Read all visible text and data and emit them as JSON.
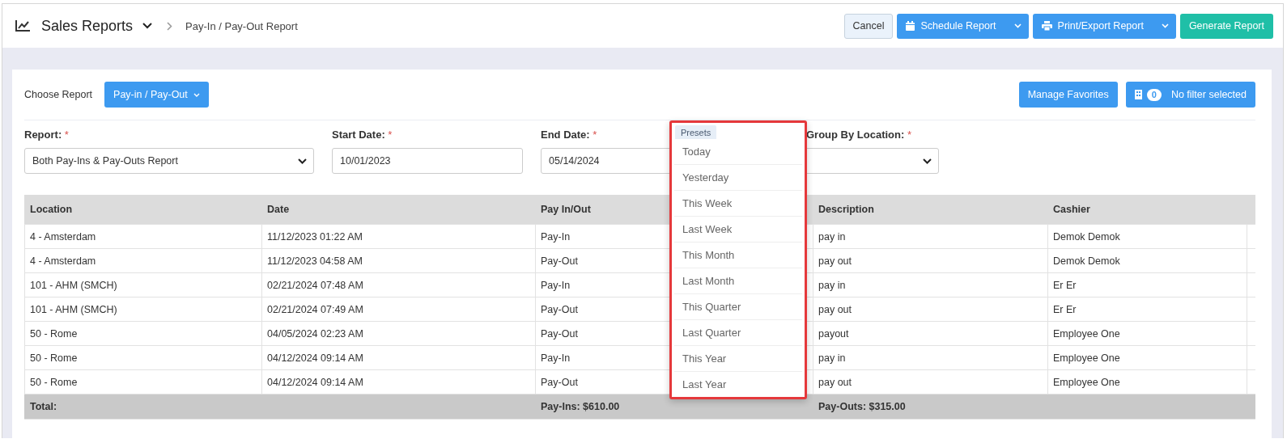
{
  "header": {
    "title": "Sales Reports",
    "breadcrumb": "Pay-In / Pay-Out Report",
    "buttons": [
      {
        "kind": "cancel",
        "label": "Cancel"
      },
      {
        "kind": "schedule",
        "label": "Schedule Report"
      },
      {
        "kind": "print",
        "label": "Print/Export Report"
      },
      {
        "kind": "primary",
        "label": "Generate Report"
      }
    ]
  },
  "toolbar": {
    "choose_label": "Choose Report",
    "report_button": "Pay-in / Pay-Out",
    "favorites_button": "Manage Favorites",
    "filter_count": "0",
    "filter_label": "No filter selected"
  },
  "filters": [
    {
      "kind": "select",
      "label": "Report:",
      "required_mark": "*",
      "value": "Both Pay-Ins & Pay-Outs Report"
    },
    {
      "kind": "text",
      "label": "Start Date:",
      "required_mark": "*",
      "value": "10/01/2023"
    },
    {
      "kind": "text",
      "label": "End Date:",
      "required_mark": "*",
      "value": "05/14/2024"
    },
    {
      "kind": "select",
      "label": "Group By Location:",
      "required_mark": "*"
    }
  ],
  "presets": {
    "tab": "Presets",
    "items": [
      "Today",
      "Yesterday",
      "This Week",
      "Last Week",
      "This Month",
      "Last Month",
      "This Quarter",
      "Last Quarter",
      "This Year",
      "Last Year"
    ]
  },
  "table": {
    "columns": [
      "Location",
      "Date",
      "Pay In/Out",
      "Description",
      "Cashier"
    ],
    "rows": [
      [
        "4 - Amsterdam",
        "11/12/2023 01:22 AM",
        "Pay-In",
        "pay in",
        "Demok Demok"
      ],
      [
        "4 - Amsterdam",
        "11/12/2023 04:58 AM",
        "Pay-Out",
        "pay out",
        "Demok Demok"
      ],
      [
        "101 - AHM (SMCH)",
        "02/21/2024 07:48 AM",
        "Pay-In",
        "pay in",
        "Er Er"
      ],
      [
        "101 - AHM (SMCH)",
        "02/21/2024 07:49 AM",
        "Pay-Out",
        "pay out",
        "Er Er"
      ],
      [
        "50 - Rome",
        "04/05/2024 02:23 AM",
        "Pay-Out",
        "payout",
        "Employee One"
      ],
      [
        "50 - Rome",
        "04/12/2024 09:14 AM",
        "Pay-In",
        "pay in",
        "Employee One"
      ],
      [
        "50 - Rome",
        "04/12/2024 09:14 AM",
        "Pay-Out",
        "pay out",
        "Employee One"
      ]
    ],
    "total": {
      "label": "Total:",
      "pay_ins": "Pay-Ins: $610.00",
      "pay_outs": "Pay-Outs: $315.00"
    }
  }
}
